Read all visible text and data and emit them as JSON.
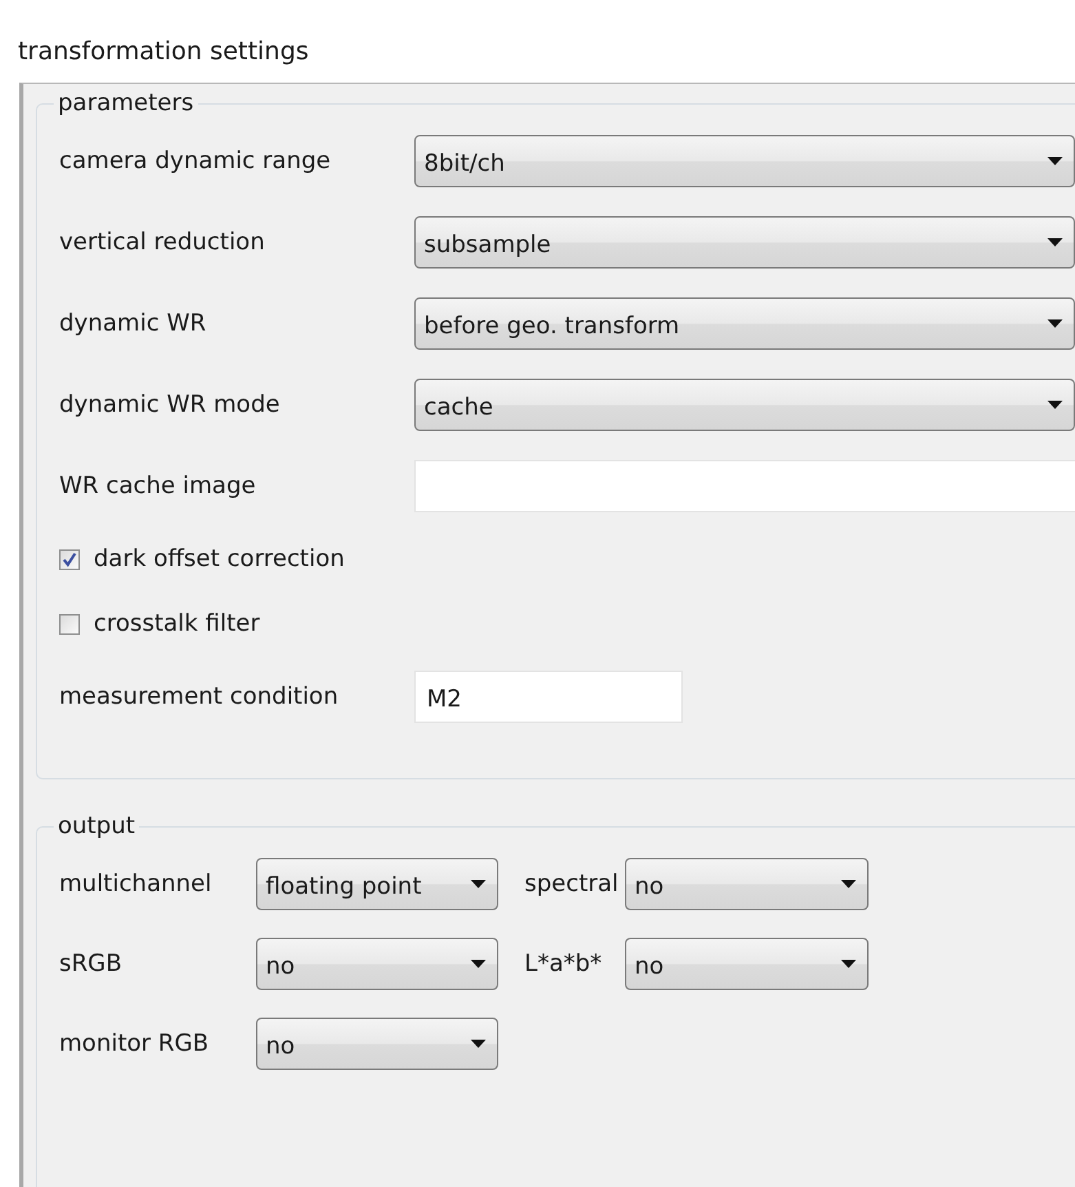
{
  "window": {
    "title": "transformation settings"
  },
  "parameters": {
    "title": "parameters",
    "rows": [
      {
        "kind": "dropdown",
        "label": "camera dynamic range",
        "value": "8bit/ch"
      },
      {
        "kind": "dropdown",
        "label": "vertical reduction",
        "value": "subsample"
      },
      {
        "kind": "dropdown",
        "label": "dynamic WR",
        "value": "before geo. transform"
      },
      {
        "kind": "dropdown",
        "label": "dynamic WR mode",
        "value": "cache"
      },
      {
        "kind": "field",
        "label": "WR cache image"
      },
      {
        "kind": "checkbox",
        "label": "dark offset correction",
        "checked": true
      },
      {
        "kind": "checkbox",
        "label": "crosstalk filter",
        "checked": false
      },
      {
        "kind": "shortfield",
        "label": "measurement condition",
        "value": "M2"
      }
    ]
  },
  "output": {
    "title": "output",
    "items": [
      {
        "label": "multichannel",
        "value": "floating point"
      },
      {
        "label": "spectral",
        "value": "no"
      },
      {
        "label": "sRGB",
        "value": "no"
      },
      {
        "label": "L*a*b*",
        "value": "no"
      },
      {
        "label": "monitor RGB",
        "value": "no"
      }
    ]
  }
}
